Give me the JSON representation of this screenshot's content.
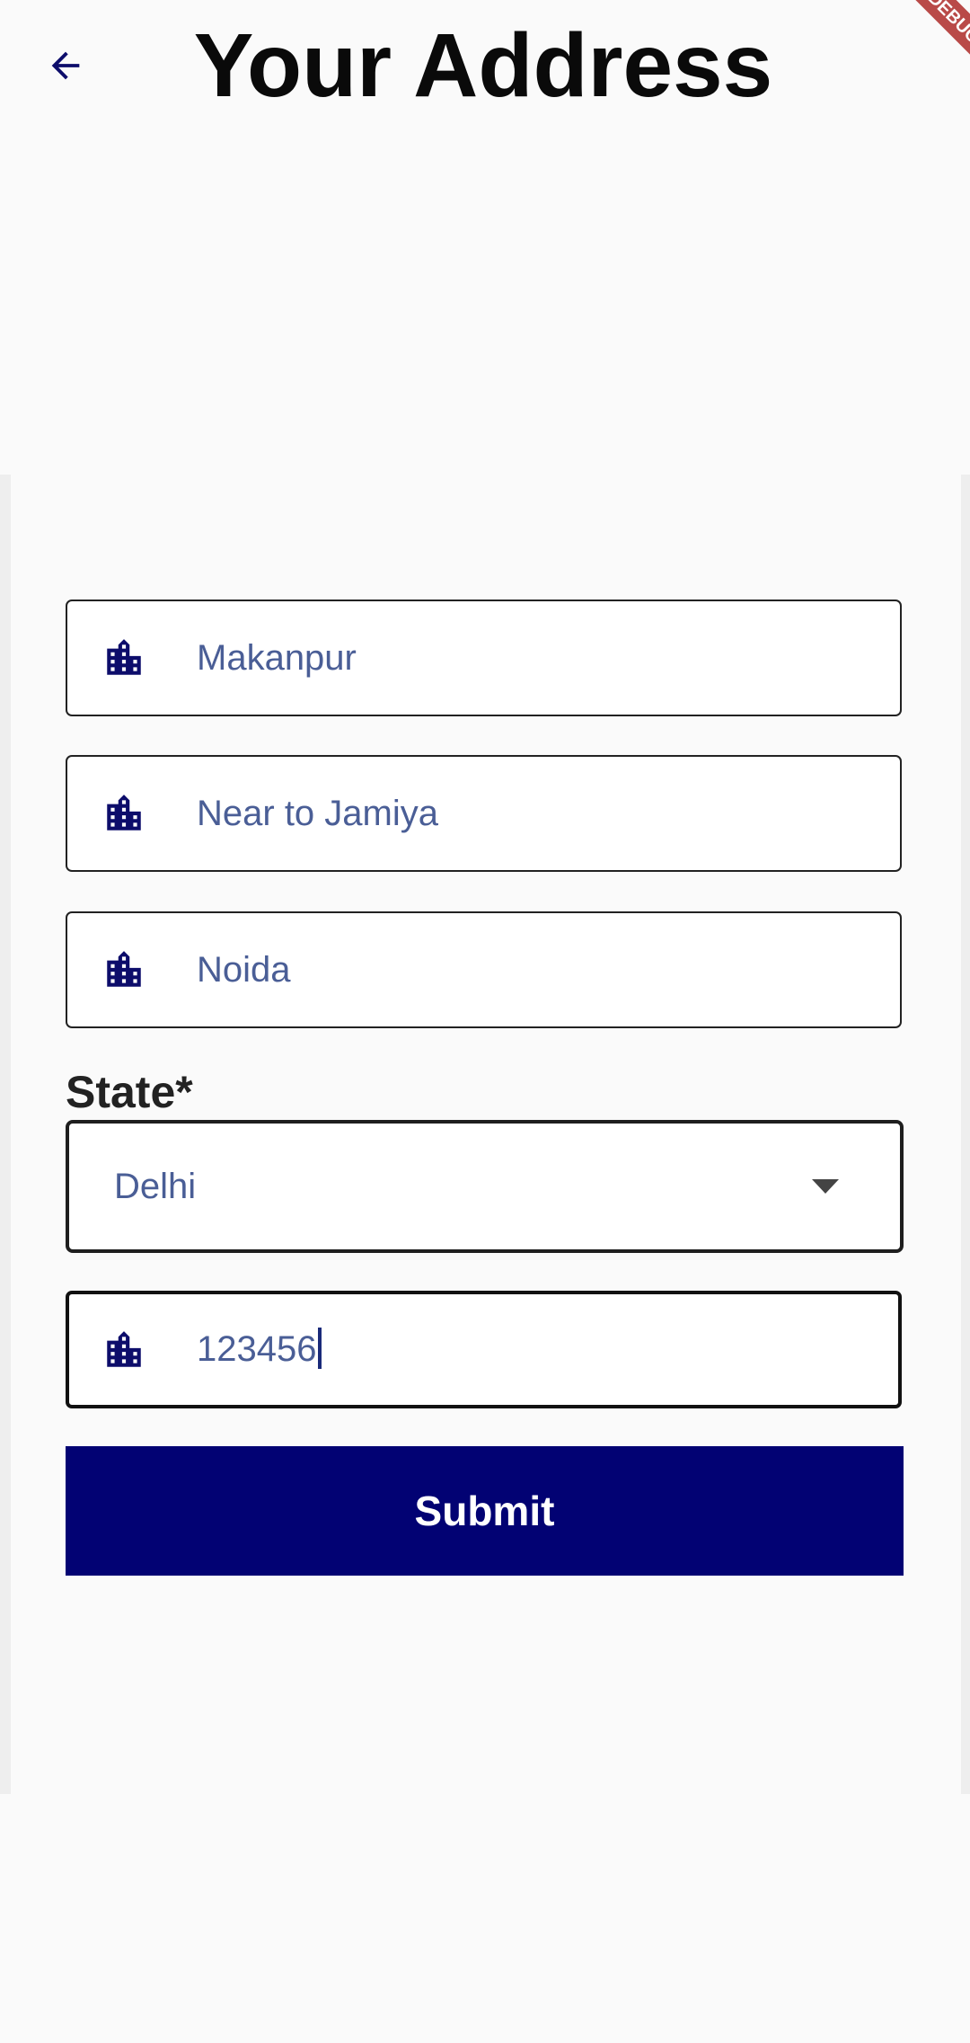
{
  "header": {
    "title": "Your Address",
    "back_icon": "arrow-back-icon",
    "ribbon_text": "DEBUG"
  },
  "form": {
    "fields": [
      {
        "icon": "location-city-icon",
        "value": "Makanpur"
      },
      {
        "icon": "location-city-icon",
        "value": "Near to Jamiya"
      },
      {
        "icon": "location-city-icon",
        "value": "Noida"
      }
    ],
    "state": {
      "label": "State*",
      "selected": "Delhi"
    },
    "pincode": {
      "icon": "location-city-icon",
      "value": "123456"
    },
    "submit_label": "Submit"
  },
  "colors": {
    "primary": "#020273",
    "icon": "#0d0d6b",
    "input_text": "#4a5e96",
    "background": "#fafafa"
  }
}
